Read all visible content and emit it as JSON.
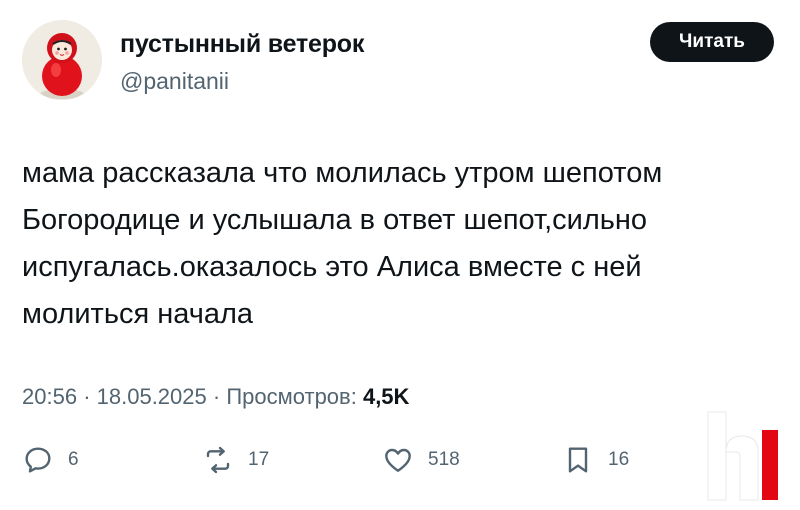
{
  "author": {
    "display_name": "пустынный ветерок",
    "handle": "@panitanii",
    "avatar_icon": "roly-poly-doll-avatar"
  },
  "follow_button": {
    "label": "Читать"
  },
  "tweet": {
    "text": "мама рассказала что молилась утром шепотом\nБогородице и услышала в ответ шепот,сильно\nиспугалась.оказалось это Алиса вместе с ней\nмолиться начала"
  },
  "meta": {
    "time": "20:56",
    "date": "18.05.2025",
    "views_label": "Просмотров:",
    "views_count": "4,5K",
    "separator": "·"
  },
  "actions": {
    "reply": {
      "icon": "reply-bubble-icon",
      "count": "6"
    },
    "repost": {
      "icon": "repost-icon",
      "count": "17"
    },
    "like": {
      "icon": "heart-icon",
      "count": "518"
    },
    "bookmark": {
      "icon": "bookmark-icon",
      "count": "16"
    }
  },
  "watermark": {
    "icon": "h-logo-watermark",
    "colors": [
      "#ffffff",
      "#e30613"
    ]
  },
  "colors": {
    "text": "#0f1419",
    "secondary": "#536471",
    "button_bg": "#0f1419"
  }
}
